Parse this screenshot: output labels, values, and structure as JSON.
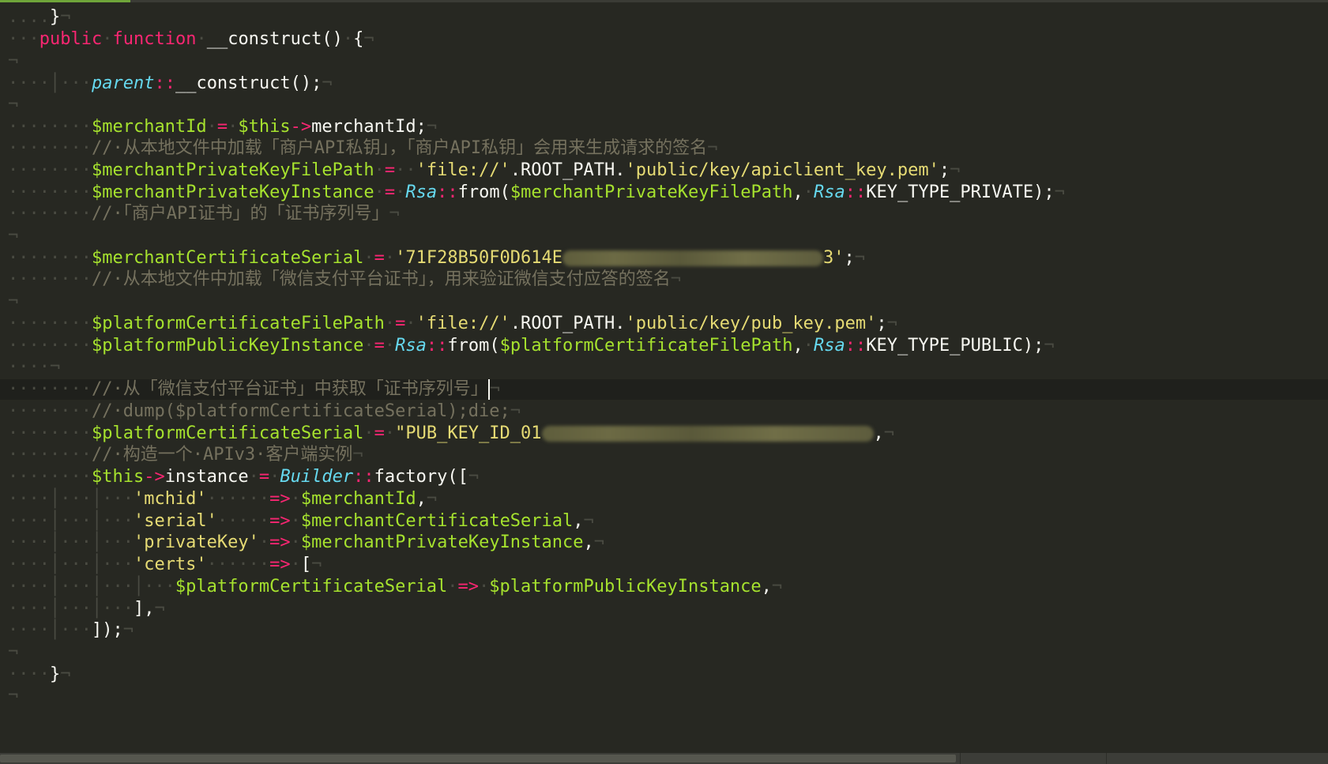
{
  "editor": {
    "lines": [
      {
        "t": "... }¬"
      },
      {
        "t": "...public function __construct() {¬"
      },
      {
        "t": "¬"
      },
      {
        "t": "........parent::__construct();¬"
      },
      {
        "t": "¬"
      },
      {
        "t": "........$merchantId = $this->merchantId;¬"
      },
      {
        "t": "........// 从本地文件中加载「商户API私钥」，「商户API私钥」会用来生成请求的签名¬"
      },
      {
        "t": "........$merchantPrivateKeyFilePath =  'file://'.ROOT_PATH.'public/key/apiclient_key.pem';¬"
      },
      {
        "t": "........$merchantPrivateKeyInstance = Rsa::from($merchantPrivateKeyFilePath, Rsa::KEY_TYPE_PRIVATE);¬"
      },
      {
        "t": "........// 「商户API证书」的「证书序列号」¬"
      },
      {
        "t": "¬"
      },
      {
        "t": "........$merchantCertificateSerial = '71F28B50F0D614E...3';¬"
      },
      {
        "t": "........// 从本地文件中加载「微信支付平台证书」，用来验证微信支付应答的签名¬"
      },
      {
        "t": "¬"
      },
      {
        "t": "........$platformCertificateFilePath = 'file://'.ROOT_PATH.'public/key/pub_key.pem';¬"
      },
      {
        "t": "........$platformPublicKeyInstance = Rsa::from($platformCertificateFilePath, Rsa::KEY_TYPE_PUBLIC);¬"
      },
      {
        "t": "....¬"
      },
      {
        "t": "........// 从「微信支付平台证书」中获取「证书序列号」¬"
      },
      {
        "t": "........// dump($platformCertificateSerial);die;¬"
      },
      {
        "t": "........$platformCertificateSerial = \"PUB_KEY_ID_01...\";¬"
      },
      {
        "t": "........// 构造一个 APIv3 客户端实例¬"
      },
      {
        "t": "........$this->instance = Builder::factory([¬"
      },
      {
        "t": "............'mchid'      => $merchantId,¬"
      },
      {
        "t": "............'serial'     => $merchantCertificateSerial,¬"
      },
      {
        "t": "............'privateKey' => $merchantPrivateKeyInstance,¬"
      },
      {
        "t": "............'certs'      => [¬"
      },
      {
        "t": "................$platformCertificateSerial => $platformPublicKeyInstance,¬"
      },
      {
        "t": "............],¬"
      },
      {
        "t": "........]);¬"
      },
      {
        "t": "¬"
      },
      {
        "t": "....}¬"
      },
      {
        "t": "¬"
      }
    ],
    "colors": {
      "background": "#272822",
      "keyword": "#f92672",
      "variable": "#a6e22e",
      "string": "#e6db74",
      "class": "#66d9ef",
      "comment": "#75715e",
      "text": "#f8f8f2"
    }
  }
}
